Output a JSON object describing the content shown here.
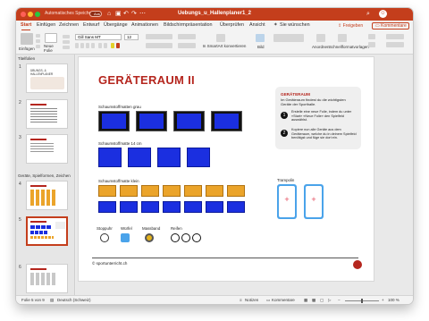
{
  "titlebar": {
    "autosave_label": "Automatisches Speichern",
    "autosave_state": "Aus",
    "document_title": "Uebungs_u_Hallenplaner1_2",
    "traffic_colors": [
      "#ff5f57",
      "#febc2e",
      "#28c840"
    ]
  },
  "tabs": {
    "items": [
      "Start",
      "Einfügen",
      "Zeichnen",
      "Entwurf",
      "Übergänge",
      "Animationen",
      "Bildschirmpräsentation",
      "Überprüfen",
      "Ansicht",
      "Sie wünschen"
    ],
    "active": "Start",
    "share_label": "Freigeben",
    "comments_label": "Kommentare"
  },
  "ribbon": {
    "paste_label": "Einfügen",
    "new_slide_label": "Neue Folie",
    "font_name": "Gill Sans MT",
    "font_size": "12",
    "smartart_label": "In SmartArt konvertieren",
    "picture_label": "Bild",
    "arrange_label": "Anordnen",
    "quickstyles_label": "Schnellformatvorlagen"
  },
  "sidebar": {
    "section1": "Titelfolien",
    "section2": "Geräte, Spielformen, Zeichen",
    "slide_numbers": [
      "1",
      "2",
      "3",
      "4",
      "5",
      "6"
    ],
    "thumb1_title": "ÜBUNGS- & HALLENPLANER",
    "selected": "5"
  },
  "slide": {
    "title": "GERÄTERAUM II",
    "mat_grey_label": "Schaumstoffmatten grau",
    "mat_14_label": "Schaumstoffmatte 14 cm",
    "mat_small_label": "Schaumstoffmatte klein",
    "trampolin_label": "Trampolin",
    "stopwatch_label": "Stoppuhr",
    "dice_label": "Würfel",
    "tape_label": "Massband",
    "hoops_label": "Reifen",
    "info": {
      "heading": "GERÄTERAUM",
      "intro": "Im Geräteraum findest du die wichtigsten Geräte der Sporthalle.",
      "step1": "Erstelle eine neue Folie, indem du unter «Start» «Neue Folie» den Spielfeld auswählst.",
      "step2": "Kopiere nun alle Geräte aus dem Geräteraum, welche du in deinem Spielfeld benötigst und füge sie dort ein."
    },
    "footer": "© sportunterricht.ch"
  },
  "status": {
    "slide_info": "Folie 5 von 9",
    "language": "Deutsch (Schweiz)",
    "notes_label": "Notizen",
    "comments_label": "Kommentare",
    "zoom": "100 %"
  },
  "colors": {
    "accent": "#c43e1c",
    "title_red": "#b5261e",
    "mat_blue": "#1b2fe0",
    "mat_orange": "#eba42a"
  }
}
